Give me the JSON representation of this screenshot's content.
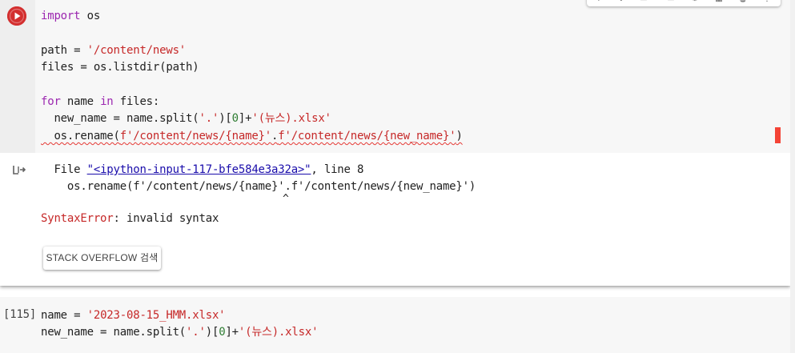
{
  "cell1": {
    "run_button": "play-icon",
    "code": {
      "l1_kw": "import",
      "l1_rest": " os",
      "l3_a": "path = ",
      "l3_str": "'/content/news'",
      "l4": "files = os.listdir(path)",
      "l6_kw1": "for",
      "l6_mid": " name ",
      "l6_kw2": "in",
      "l6_rest": " files:",
      "l7_a": "  new_name = name.split(",
      "l7_str1": "'.'",
      "l7_b": ")[",
      "l7_num": "0",
      "l7_c": "]+",
      "l7_str2": "'(뉴스).xlsx'",
      "l8_a": "  os.rename(",
      "l8_str1": "f'/content/news/{name}'",
      "l8_b": ".",
      "l8_str2": "f'/content/news/{new_name}'",
      "l8_c": ")"
    },
    "output": {
      "file_prefix": "  File ",
      "file_link": "\"<ipython-input-117-bfe584e3a32a>\"",
      "file_suffix": ", line 8",
      "code_line": "    os.rename(f'/content/news/{name}'.f'/content/news/{new_name}')",
      "caret": "^",
      "error_type": "SyntaxError",
      "error_msg": ": invalid syntax",
      "so_button": "STACK OVERFLOW 검색"
    }
  },
  "cell2": {
    "exec_count": "[115]",
    "l1_a": "name = ",
    "l1_str": "'2023-08-15_HMM.xlsx'",
    "l2_a": "new_name = name.split(",
    "l2_str1": "'.'",
    "l2_b": ")[",
    "l2_num": "0",
    "l2_c": "]+",
    "l2_str2": "'(뉴스).xlsx'"
  },
  "colors": {
    "keyword": "#9c27b0",
    "string": "#c62828",
    "number": "#2e7d32",
    "run_button": "#d32f2f",
    "error_marker": "#f44336",
    "link": "#1a0dab"
  }
}
